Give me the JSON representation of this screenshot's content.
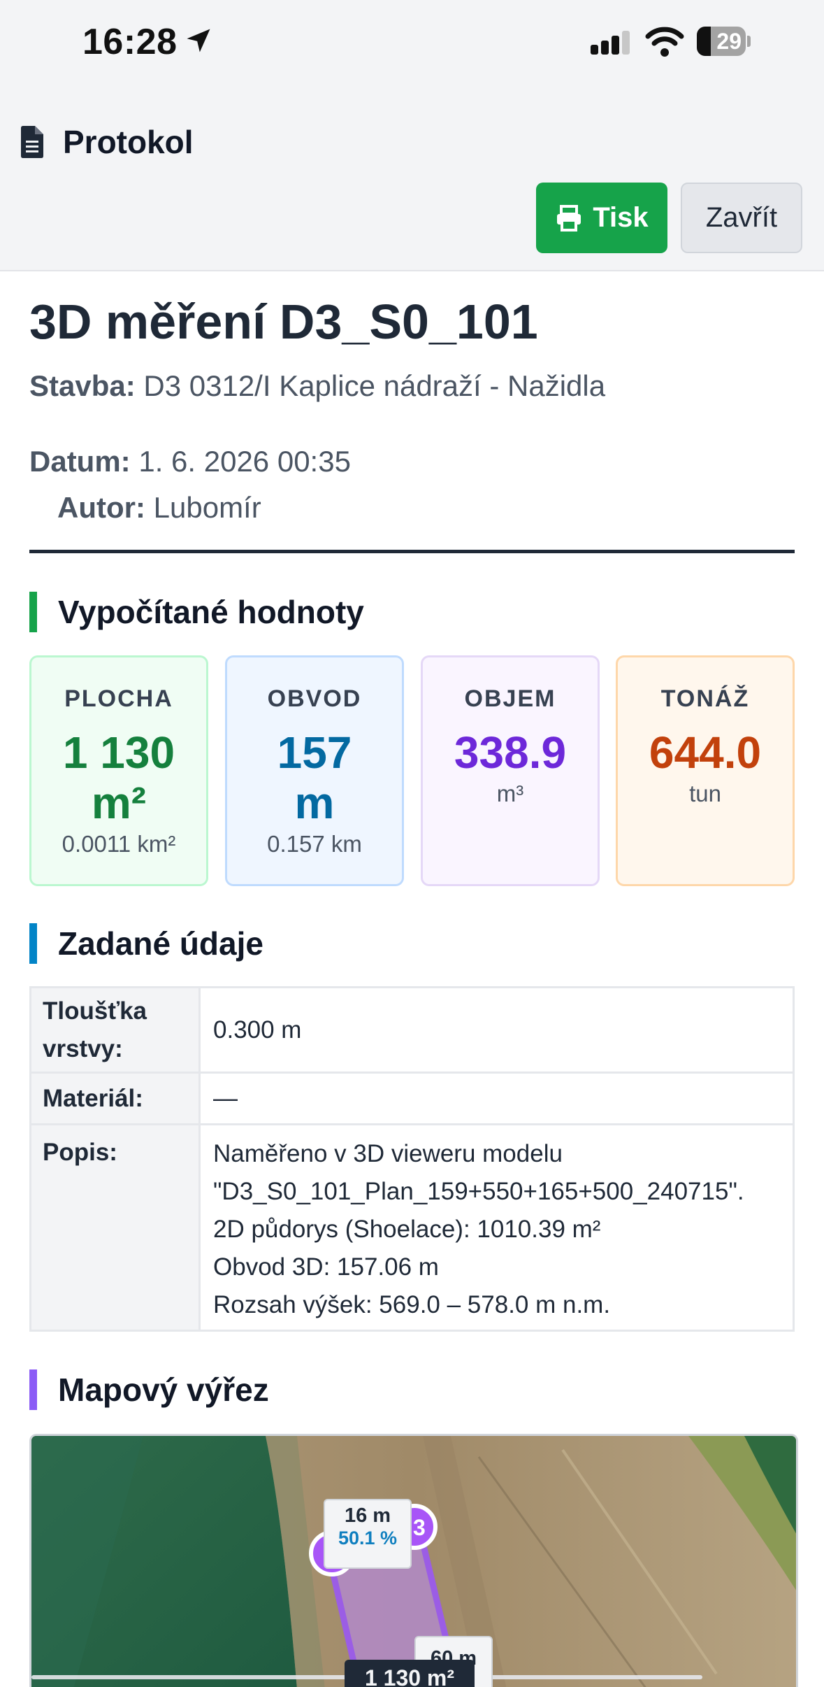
{
  "status_bar": {
    "time": "16:28",
    "battery": "29",
    "battery_level": 0.29
  },
  "header": {
    "title": "Protokol",
    "print_label": "Tisk",
    "close_label": "Zavřít"
  },
  "document": {
    "title": "3D měření D3_S0_101",
    "stavba_label": "Stavba:",
    "stavba_value": "D3 0312/I Kaplice nádraží - Nažidla",
    "datum_label": "Datum:",
    "datum_value": "1. 6. 2026 00:35",
    "autor_label": "Autor:",
    "autor_value": "Lubomír"
  },
  "sections": {
    "computed": "Vypočítané hodnoty",
    "inputs": "Zadané údaje",
    "map": "Mapový výřez"
  },
  "cards": [
    {
      "label": "PLOCHA",
      "value_line1": "1 130",
      "value_line2": "m²",
      "sub": "0.0011 km²",
      "color": "#15803d",
      "bg": "#f0fdf4",
      "border": "#bbf7d0"
    },
    {
      "label": "OBVOD",
      "value_line1": "157",
      "value_line2": "m",
      "sub": "0.157 km",
      "color": "#0369a1",
      "bg": "#eff6ff",
      "border": "#bfdbfe"
    },
    {
      "label": "OBJEM",
      "value_line1": "338.9",
      "value_line2": "",
      "sub": "m³",
      "color": "#6d28d9",
      "bg": "#faf5ff",
      "border": "#e5d8f7"
    },
    {
      "label": "TONÁŽ",
      "value_line1": "644.0",
      "value_line2": "",
      "sub": "tun",
      "color": "#c2410c",
      "bg": "#fff7ed",
      "border": "#fed7aa"
    }
  ],
  "table": {
    "rows": [
      {
        "key_line1": "Tloušťka",
        "key_line2": "vrstvy:",
        "value": "0.300 m"
      },
      {
        "key": "Materiál:",
        "value": "—"
      },
      {
        "key": "Popis:",
        "lines": [
          "Naměřeno v 3D vieweru modelu",
          "\"D3_S0_101_Plan_159+550+165+500_240715\".",
          "2D půdorys (Shoelace): 1010.39 m²",
          "Obvod 3D: 157.06 m",
          "Rozsah výšek: 569.0 – 578.0 m n.m."
        ]
      }
    ]
  },
  "map": {
    "label1_line1": "16 m",
    "label1_line2": "50.1 %",
    "label2": "60 m",
    "area_label": "1 130 m²",
    "vertex_label": "3"
  },
  "colors": {
    "green_accent": "#16a34a",
    "blue_accent": "#0284c7",
    "purple_accent": "#8b5cf6"
  }
}
